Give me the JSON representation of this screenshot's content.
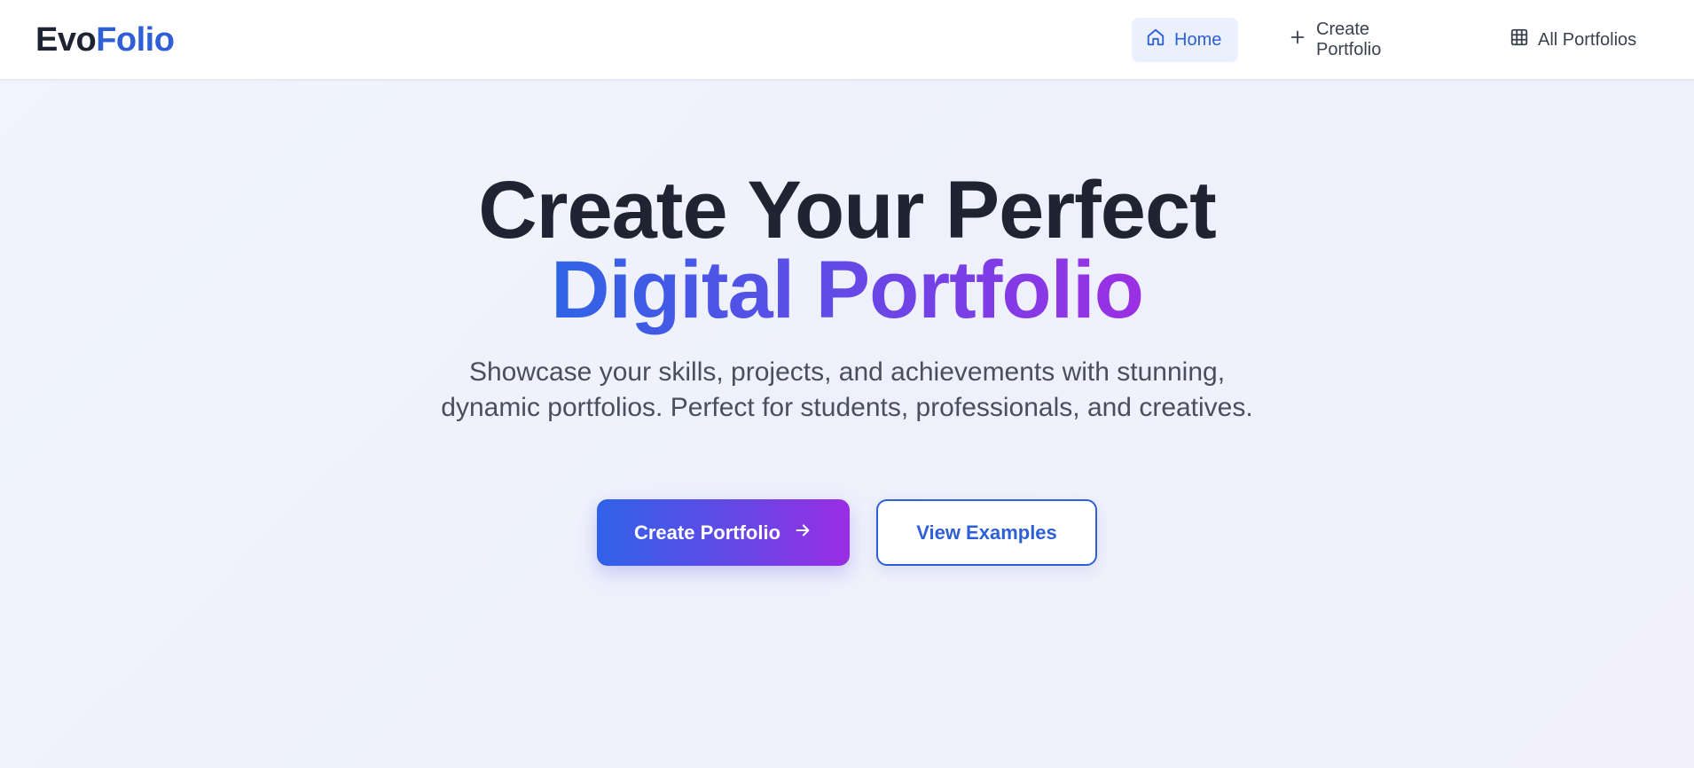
{
  "header": {
    "logo": {
      "part1": "Evo",
      "part2": "Folio"
    },
    "nav": [
      {
        "label": "Home",
        "icon": "home-icon",
        "active": true
      },
      {
        "label": "Create Portfolio",
        "icon": "plus-icon",
        "active": false
      },
      {
        "label": "All Portfolios",
        "icon": "grid-icon",
        "active": false
      }
    ]
  },
  "hero": {
    "title_line1": "Create Your Perfect",
    "title_line2": "Digital Portfolio",
    "subtitle": "Showcase your skills, projects, and achievements with stunning, dynamic portfolios. Perfect for students, professionals, and creatives.",
    "primary_button": {
      "label": "Create Portfolio",
      "icon": "arrow-right-icon"
    },
    "secondary_button": {
      "label": "View Examples"
    }
  },
  "colors": {
    "brand_blue": "#2f5fd6",
    "gradient_start": "#2f62e8",
    "gradient_end": "#9a2de4",
    "text_dark": "#1f2433",
    "text_muted": "#4a4f5c"
  }
}
